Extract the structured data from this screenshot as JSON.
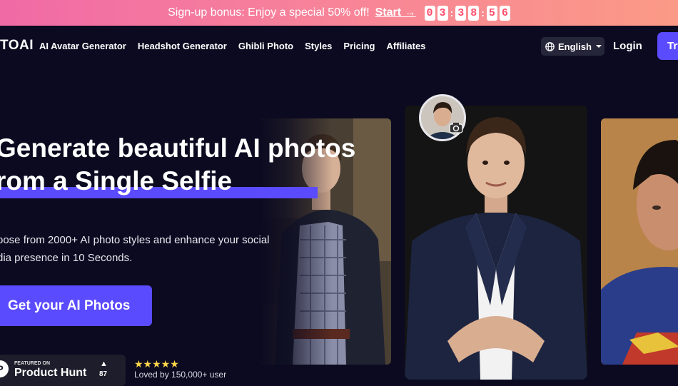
{
  "promo": {
    "text": "Sign-up bonus: Enjoy a special 50% off!",
    "start_label": "Start →",
    "countdown": [
      "0",
      "3",
      "3",
      "8",
      "5",
      "6"
    ]
  },
  "nav": {
    "logo": "TOAI",
    "items": [
      "AI Avatar Generator",
      "Headshot Generator",
      "Ghibli Photo",
      "Styles",
      "Pricing",
      "Affiliates"
    ],
    "language": "English",
    "login": "Login",
    "try": "Try"
  },
  "hero": {
    "headline_line1": "Generate beautiful AI photos",
    "headline_line2": "rom a Single Selfie",
    "subtext_line1": "oose from 2000+ AI photo styles and enhance your social",
    "subtext_line2": "dia presence in 10 Seconds.",
    "cta": "Get your AI Photos"
  },
  "product_hunt": {
    "featured": "FEATURED ON",
    "name": "Product Hunt",
    "count": "87"
  },
  "rating": {
    "stars": "★★★★★",
    "loved": "Loved by 150,000+ user"
  },
  "colors": {
    "accent": "#5b4bff",
    "background": "#0b0a20",
    "banner_start": "#f06aa6",
    "banner_end": "#fb9a86"
  }
}
